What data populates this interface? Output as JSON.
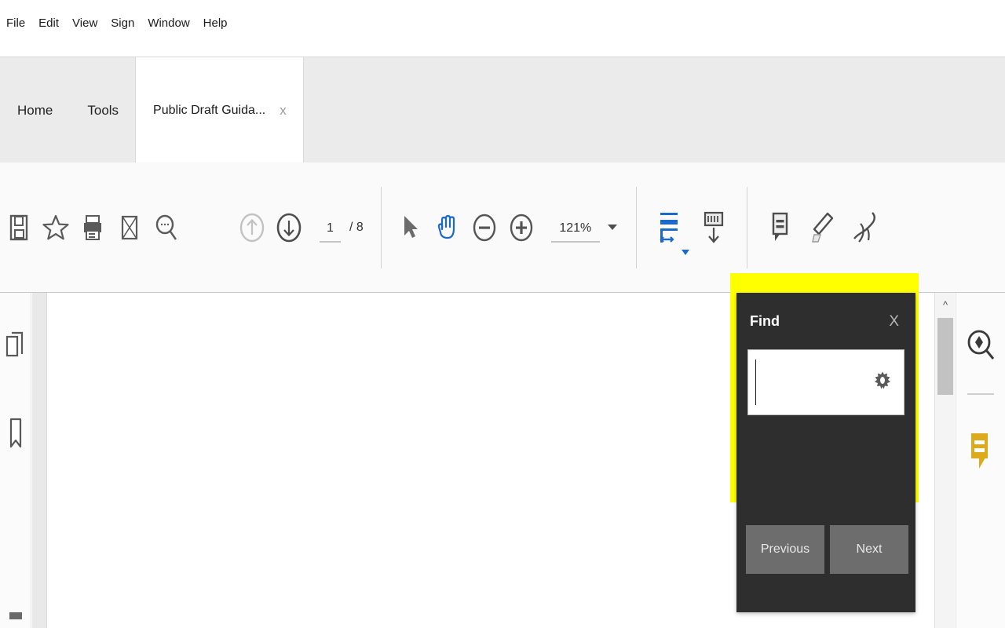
{
  "menubar": {
    "items": [
      {
        "label": "File",
        "name": "menu-file"
      },
      {
        "label": "Edit",
        "name": "menu-edit"
      },
      {
        "label": "View",
        "name": "menu-view"
      },
      {
        "label": "Sign",
        "name": "menu-sign"
      },
      {
        "label": "Window",
        "name": "menu-window"
      },
      {
        "label": "Help",
        "name": "menu-help"
      }
    ]
  },
  "tabs": {
    "home_label": "Home",
    "tools_label": "Tools",
    "document_label": "Public Draft Guida...",
    "close_label": "x"
  },
  "toolbar": {
    "icons": {
      "save": "save-icon",
      "favorite": "star-icon",
      "print": "printer-icon",
      "email": "envelope-icon",
      "search": "search-icon",
      "page_up": "arrow-up-circle-icon",
      "page_down": "arrow-down-circle-icon",
      "select": "cursor-arrow-icon",
      "hand": "hand-tool-icon",
      "zoom_out": "minus-circle-icon",
      "zoom_in": "plus-circle-icon",
      "fit_width": "fit-width-icon",
      "scroll_mode": "scroll-page-icon",
      "comment": "comment-bubble-icon",
      "highlight": "highlighter-pen-icon",
      "sign": "signature-icon"
    },
    "page_current": "1",
    "page_separator": "/",
    "page_total": "8",
    "zoom_level": "121%",
    "active_tool_color": "#1b6ac9"
  },
  "left_rail": {
    "thumbnails": "page-thumbnails-icon",
    "bookmarks": "bookmark-icon"
  },
  "right_rail": {
    "search": "search-document-icon",
    "comment": "comment-bubble-icon",
    "comment_color": "#ddaa1c"
  },
  "scrollbar": {
    "up_arrow": "^"
  },
  "find_dialog": {
    "title": "Find",
    "close_label": "X",
    "input_value": "",
    "input_placeholder": "",
    "settings_icon": "gear-icon",
    "previous_label": "Previous",
    "next_label": "Next",
    "highlight_color": "#ffff00",
    "panel_color": "#2e2e2e",
    "button_color": "#6d6d6d"
  }
}
